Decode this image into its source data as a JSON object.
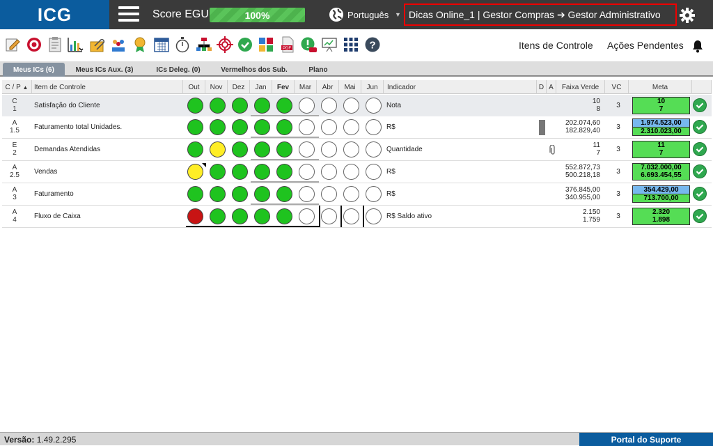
{
  "app": {
    "logo": "ICG"
  },
  "header": {
    "score_label": "Score EGU:",
    "score_value": "100%",
    "score_fraction": 1.0,
    "language": "Português",
    "context_text": "Dicas Online_1  |  Gestor Compras ➔ Gestor Administrativo"
  },
  "toolbar": {
    "icons": [
      "edit-icon",
      "target-icon",
      "clipboard-icon",
      "bar-chart-icon",
      "paperclip-icon",
      "team-icon",
      "award-icon",
      "calendar-icon",
      "stopwatch-icon",
      "org-chart-icon",
      "crosshair-icon",
      "check-icon",
      "puzzle-icon",
      "pdf-icon",
      "alert-off-icon",
      "presentation-icon",
      "apps-grid-icon",
      "help-icon"
    ],
    "itens_controle": "Itens de Controle",
    "acoes_pendentes": "Ações Pendentes"
  },
  "tabs": [
    {
      "label": "Meus ICs (6)",
      "active": true
    },
    {
      "label": "Meus ICs Aux. (3)",
      "active": false
    },
    {
      "label": "ICs Deleg. (0)",
      "active": false
    },
    {
      "label": "Vermelhos dos Sub.",
      "active": false
    },
    {
      "label": "Plano",
      "active": false
    }
  ],
  "table": {
    "headers": {
      "cp": "C / P",
      "item": "Item de Controle",
      "months": [
        "Out",
        "Nov",
        "Dez",
        "Jan",
        "Fev",
        "Mar",
        "Abr",
        "Mai",
        "Jun"
      ],
      "indicador": "Indicador",
      "d": "D",
      "a": "A",
      "faixa": "Faixa Verde",
      "vc": "VC",
      "meta": "Meta"
    },
    "rows": [
      {
        "c": "C",
        "p": "1",
        "name": "Satisfação do Cliente",
        "status": [
          "green",
          "green",
          "green",
          "green",
          "green",
          "empty",
          "empty",
          "empty",
          "empty"
        ],
        "indicador": "Nota",
        "faixa_top": "10",
        "faixa_bot": "8",
        "vc": "3",
        "meta_top": "10",
        "meta_bot": "7",
        "meta_style": "green"
      },
      {
        "c": "A",
        "p": "1.5",
        "name": "Faturamento total Unidades.",
        "status": [
          "green",
          "green",
          "green",
          "green",
          "green",
          "empty",
          "empty",
          "empty",
          "empty"
        ],
        "indicador": "R$",
        "faixa_top": "202.074,60",
        "faixa_bot": "182.829,40",
        "vc": "3",
        "meta_top": "1.974.523,00",
        "meta_bot": "2.310.023,00",
        "meta_style": "blue"
      },
      {
        "c": "E",
        "p": "2",
        "name": "Demandas Atendidas",
        "status": [
          "green",
          "yellow",
          "green",
          "green",
          "green",
          "empty",
          "empty",
          "empty",
          "empty"
        ],
        "indicador": "Quantidade",
        "faixa_top": "11",
        "faixa_bot": "7",
        "vc": "3",
        "meta_top": "11",
        "meta_bot": "7",
        "meta_style": "green"
      },
      {
        "c": "A",
        "p": "2.5",
        "name": "Vendas",
        "status": [
          "yellow",
          "green",
          "green",
          "green",
          "green",
          "empty",
          "empty",
          "empty",
          "empty"
        ],
        "indicador": "R$",
        "faixa_top": "552.872,73",
        "faixa_bot": "500.218,18",
        "vc": "3",
        "meta_top": "7.032.000,00",
        "meta_bot": "6.693.454,55",
        "meta_style": "green"
      },
      {
        "c": "A",
        "p": "3",
        "name": "Faturamento",
        "status": [
          "green",
          "green",
          "green",
          "green",
          "green",
          "empty",
          "empty",
          "empty",
          "empty"
        ],
        "indicador": "R$",
        "faixa_top": "376.845,00",
        "faixa_bot": "340.955,00",
        "vc": "3",
        "meta_top": "354.429,00",
        "meta_bot": "713.700,00",
        "meta_style": "blue"
      },
      {
        "c": "A",
        "p": "4",
        "name": "Fluxo de Caixa",
        "status": [
          "red",
          "green",
          "green",
          "green",
          "green",
          "empty",
          "empty",
          "empty",
          "empty"
        ],
        "indicador": "R$ Saldo ativo",
        "faixa_top": "2.150",
        "faixa_bot": "1.759",
        "vc": "3",
        "meta_top": "2.320",
        "meta_bot": "1.898",
        "meta_style": "green"
      }
    ]
  },
  "footer": {
    "version_label": "Versão:",
    "version": "1.49.2.295",
    "portal": "Portal do Suporte"
  },
  "colors": {
    "brand": "#0b5c9e",
    "green": "#1fc31f",
    "yellow": "#ffee26",
    "red": "#c81414"
  }
}
